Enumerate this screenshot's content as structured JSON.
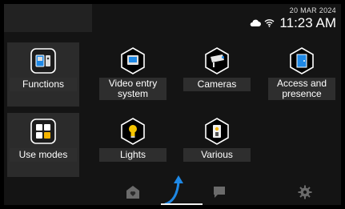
{
  "status": {
    "date": "20 MAR 2024",
    "time": "11:23 AM",
    "icons": [
      "cloud-icon",
      "wifi-icon"
    ]
  },
  "menu": {
    "items": [
      {
        "label": "Functions",
        "icon": "intercom-icon"
      },
      {
        "label": "Video entry system",
        "line1": "Video entry",
        "line2": "system",
        "icon": "monitor-icon"
      },
      {
        "label": "Cameras",
        "icon": "camera-icon"
      },
      {
        "label": "Access and presence",
        "line1": "Access and",
        "line2": "presence",
        "icon": "door-icon"
      },
      {
        "label": "Use modes",
        "icon": "grid-icon"
      },
      {
        "label": "Lights",
        "icon": "bulb-icon"
      },
      {
        "label": "Various",
        "icon": "switch-icon"
      }
    ]
  },
  "bottom_nav": [
    "home-icon",
    "chat-icon",
    "settings-icon"
  ],
  "colors": {
    "background": "#141414",
    "accent_blue": "#1e88e5",
    "accent_yellow": "#f5b400",
    "label_bg": "#2e2e2e"
  }
}
